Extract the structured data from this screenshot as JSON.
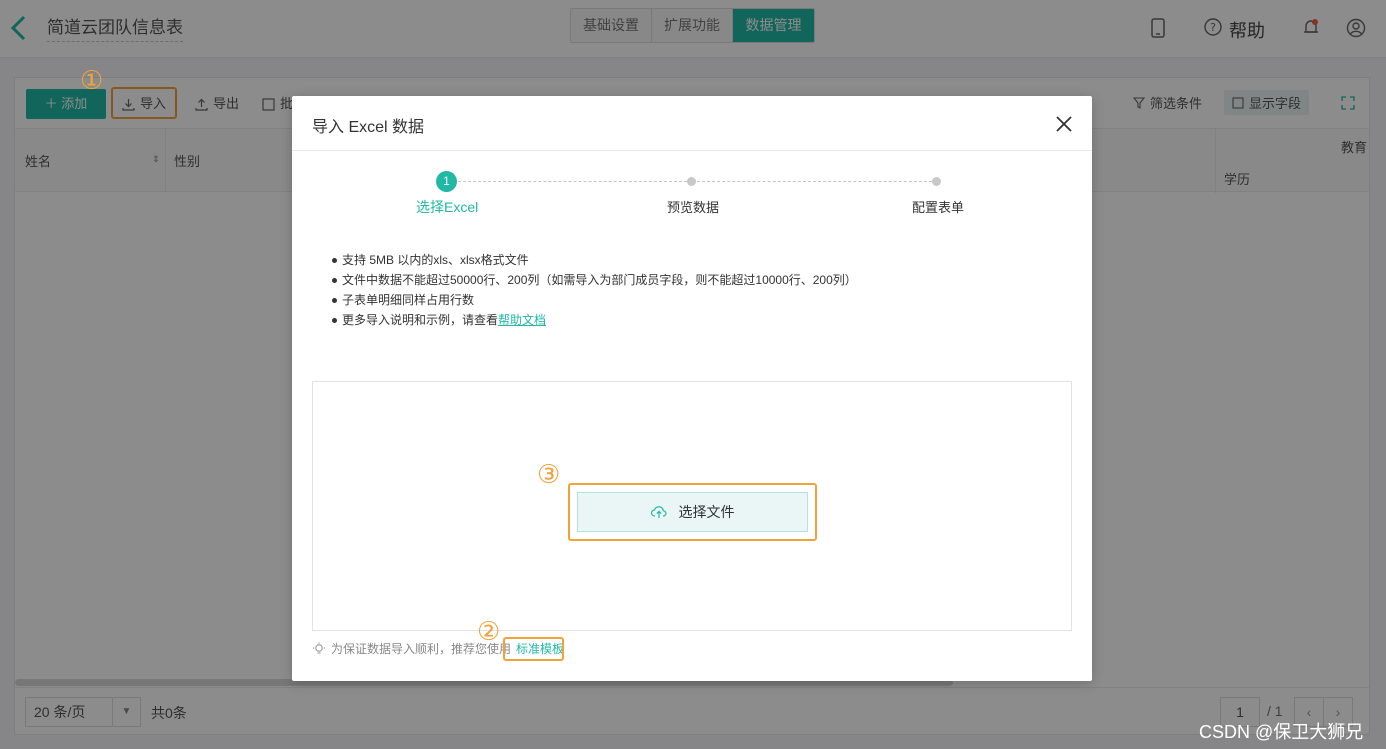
{
  "header": {
    "title": "简道云团队信息表",
    "tabs": [
      "基础设置",
      "扩展功能",
      "数据管理"
    ],
    "active_tab": 2,
    "help_label": "帮助"
  },
  "toolbar": {
    "add_label": "添加",
    "import_label": "导入",
    "export_label": "导出",
    "batch_label": "批",
    "filter_label": "筛选条件",
    "fields_label": "显示字段"
  },
  "grid": {
    "columns": [
      "姓名",
      "性别"
    ],
    "right_group_label": "教育",
    "right_sub_label": "学历"
  },
  "footer": {
    "page_size": "20 条/页",
    "total": "共0条",
    "current_page": "1",
    "total_pages": "/ 1"
  },
  "modal": {
    "title": "导入 Excel 数据",
    "steps": [
      "选择Excel",
      "预览数据",
      "配置表单"
    ],
    "step_number": "1",
    "notes": [
      "支持 5MB 以内的xls、xlsx格式文件",
      "文件中数据不能超过50000行、200列（如需导入为部门成员字段，则不能超过10000行、200列）",
      "子表单明细同样占用行数"
    ],
    "notes_last_prefix": "更多导入说明和示例，请查看",
    "notes_last_link": "帮助文档",
    "select_file_label": "选择文件",
    "tip_text": "为保证数据导入顺利，推荐您使用",
    "tip_link": "标准模板"
  },
  "annotations": [
    "①",
    "②",
    "③"
  ],
  "watermark": "CSDN @保卫大狮兄",
  "colors": {
    "accent": "#22b8a6",
    "highlight": "#f0a23b"
  }
}
